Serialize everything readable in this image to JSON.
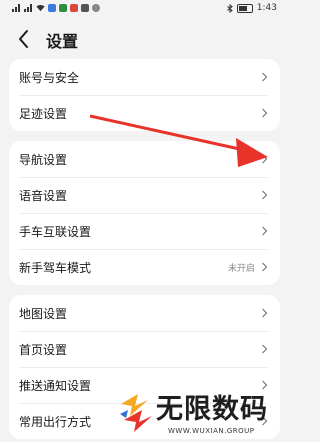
{
  "status_bar": {
    "time": "1:43"
  },
  "header": {
    "title": "设置"
  },
  "groups": [
    {
      "items": [
        {
          "label": "账号与安全"
        },
        {
          "label": "足迹设置"
        }
      ]
    },
    {
      "items": [
        {
          "label": "导航设置"
        },
        {
          "label": "语音设置"
        },
        {
          "label": "手车互联设置"
        },
        {
          "label": "新手驾车模式",
          "value": "未开启"
        }
      ]
    },
    {
      "items": [
        {
          "label": "地图设置"
        },
        {
          "label": "首页设置"
        },
        {
          "label": "推送通知设置"
        },
        {
          "label": "常用出行方式"
        }
      ]
    }
  ],
  "watermark": {
    "text": "无限数码",
    "subtext": "WWW.WUXIAN.GROUP"
  },
  "colors": {
    "annotation_arrow": "#e8332b",
    "background": "#f3f3f3",
    "card": "#ffffff"
  }
}
